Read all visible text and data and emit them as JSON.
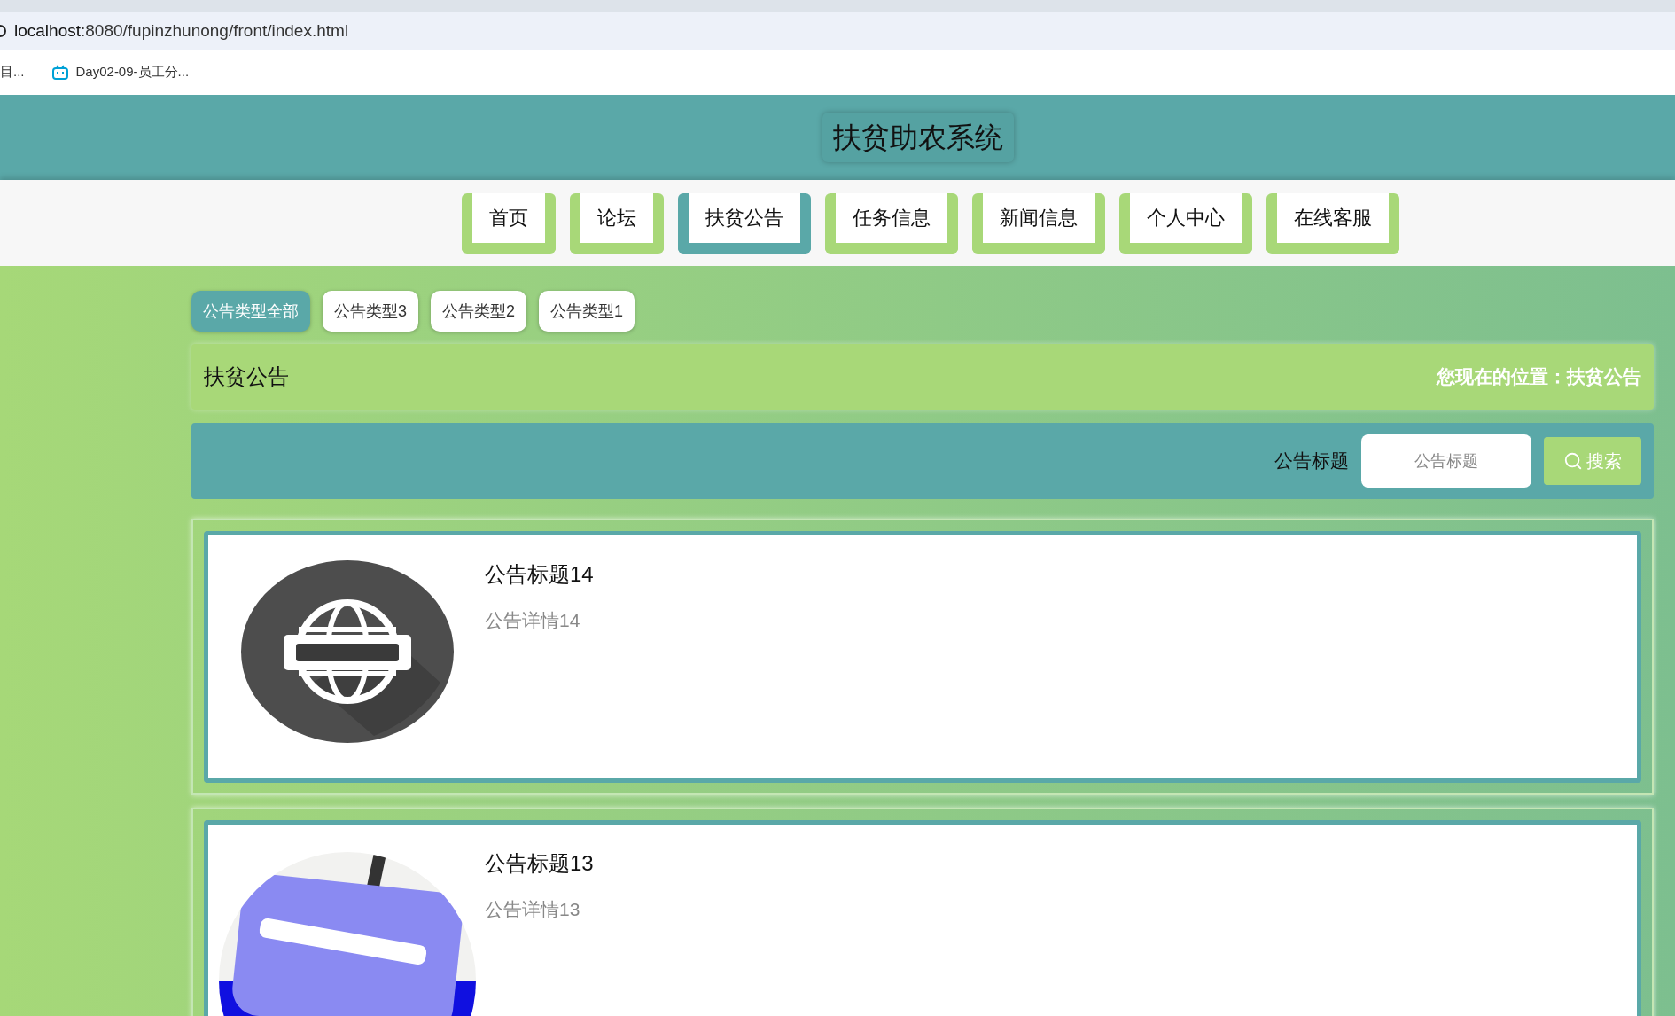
{
  "browser": {
    "host": "localhost",
    "path": ":8080/fupinzhunong/front/index.html",
    "bookmarks": [
      {
        "label": "目...",
        "kind": "plain"
      },
      {
        "label": "Day02-09-员工分...",
        "kind": "tv"
      }
    ]
  },
  "site_title": "扶贫助农系统",
  "nav": [
    {
      "label": "首页",
      "selected": false
    },
    {
      "label": "论坛",
      "selected": false
    },
    {
      "label": "扶贫公告",
      "selected": true
    },
    {
      "label": "任务信息",
      "selected": false
    },
    {
      "label": "新闻信息",
      "selected": false
    },
    {
      "label": "个人中心",
      "selected": false
    },
    {
      "label": "在线客服",
      "selected": false
    }
  ],
  "categories": [
    {
      "label": "公告类型全部",
      "selected": true
    },
    {
      "label": "公告类型3",
      "selected": false
    },
    {
      "label": "公告类型2",
      "selected": false
    },
    {
      "label": "公告类型1",
      "selected": false
    }
  ],
  "section": {
    "title": "扶贫公告",
    "breadcrumb": "您现在的位置：扶贫公告"
  },
  "search": {
    "label": "公告标题",
    "placeholder": "公告标题",
    "button": "搜索"
  },
  "notices": [
    {
      "title": "公告标题14",
      "detail": "公告详情14"
    },
    {
      "title": "公告标题13",
      "detail": "公告详情13"
    }
  ]
}
